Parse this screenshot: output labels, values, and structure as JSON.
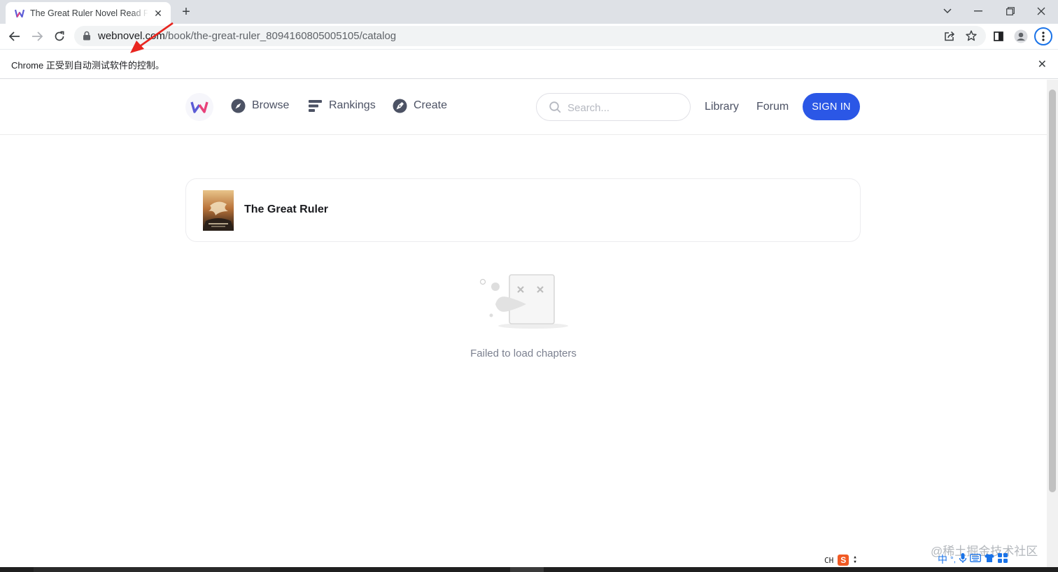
{
  "browser": {
    "tab_title": "The Great Ruler Novel Read Free - Webnovel",
    "url_host": "webnovel.com",
    "url_path": "/book/the-great-ruler_8094160805005105/catalog",
    "infobar_message": "Chrome 正受到自动测试软件的控制。"
  },
  "site": {
    "nav": {
      "browse": "Browse",
      "rankings": "Rankings",
      "create": "Create"
    },
    "search_placeholder": "Search...",
    "library": "Library",
    "forum": "Forum",
    "signin": "SIGN IN",
    "accent_color": "#2b57e6"
  },
  "book": {
    "title": "The Great Ruler"
  },
  "empty_state": {
    "message": "Failed to load chapters"
  },
  "system": {
    "ime_label": "CH",
    "ime_brand": "S",
    "ime_mode": "中",
    "watermark": "@稀土掘金技术社区"
  }
}
